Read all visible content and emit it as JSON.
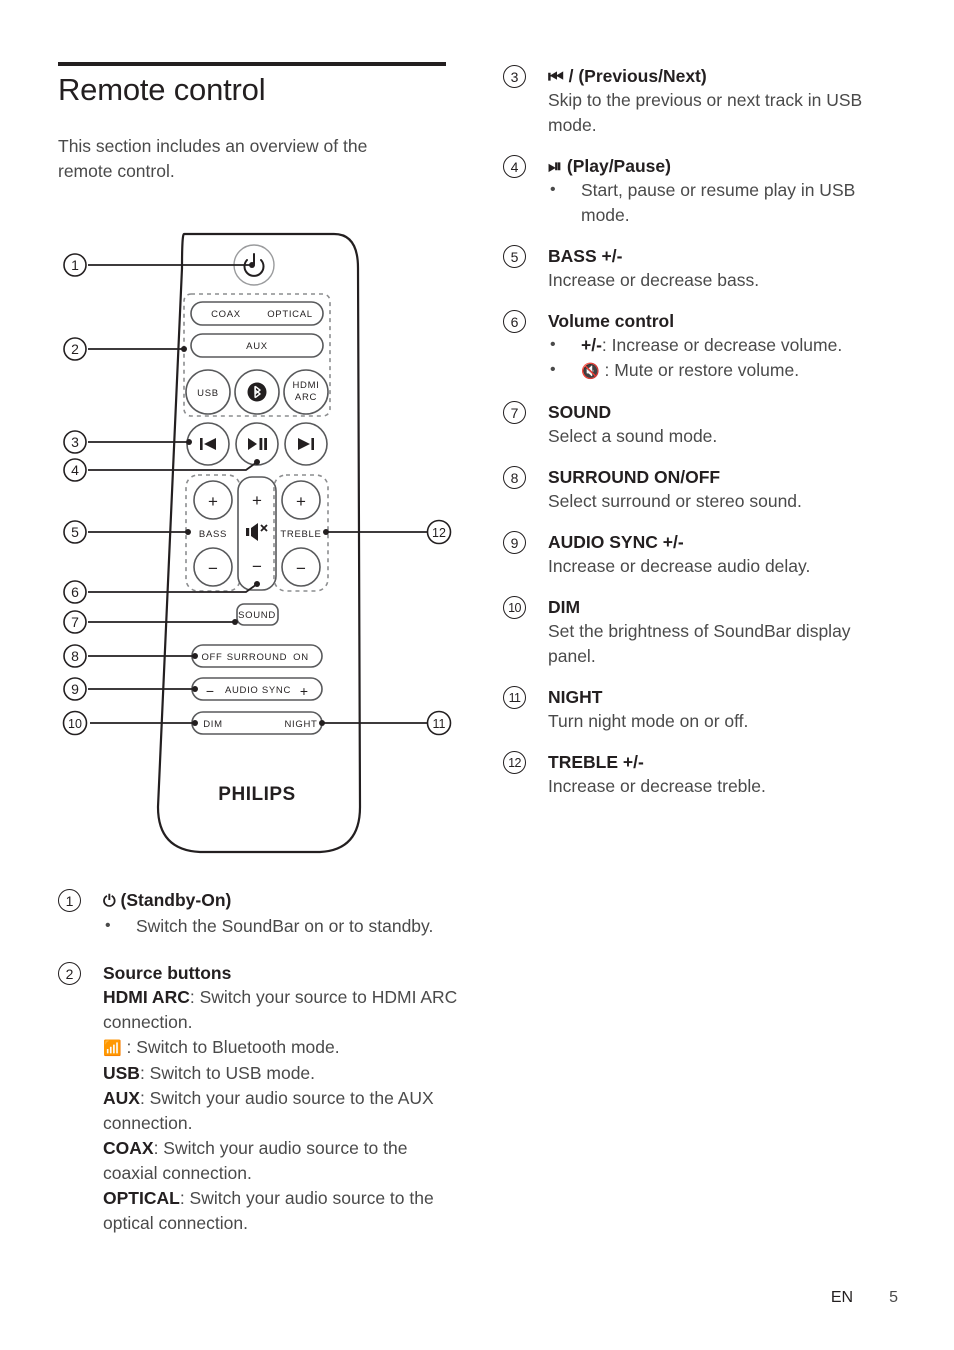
{
  "heading": {
    "title": "Remote control",
    "intro": "This section includes an overview of the remote control."
  },
  "remote": {
    "brand": "PHILIPS",
    "power_icon": "power-standby-icon",
    "buttons": {
      "coax": "COAX",
      "optical": "OPTICAL",
      "aux": "AUX",
      "usb": "USB",
      "bluetooth": "bluetooth-icon",
      "hdmi_arc_line1": "HDMI",
      "hdmi_arc_line2": "ARC",
      "previous": "previous-track-icon",
      "play_pause": "play-pause-icon",
      "next": "next-track-icon",
      "bass_plus": "+",
      "bass_label": "BASS",
      "bass_minus": "−",
      "volume_plus": "+",
      "volume_mute": "mute-icon",
      "volume_minus": "−",
      "treble_plus": "+",
      "treble_label": "TREBLE",
      "treble_minus": "−",
      "sound": "SOUND",
      "surround_off": "OFF",
      "surround_label": "SURROUND",
      "surround_on": "ON",
      "audio_sync_minus": "−",
      "audio_sync_label": "AUDIO SYNC",
      "audio_sync_plus": "+",
      "dim": "DIM",
      "night": "NIGHT"
    },
    "callouts": [
      "1",
      "2",
      "3",
      "4",
      "5",
      "6",
      "7",
      "8",
      "9",
      "10",
      "11",
      "12"
    ]
  },
  "legend_left": [
    {
      "num": "1",
      "title_glyph": "⏻",
      "title": " (Standby-On)",
      "bullets": [
        "Switch the SoundBar on or to standby."
      ]
    },
    {
      "num": "2",
      "title": "Source buttons",
      "lines": [
        {
          "term": "HDMI ARC",
          "rest": ": Switch your source to HDMI ARC connection."
        },
        {
          "term": "ᛗ",
          "rest": " : Switch to Bluetooth mode."
        },
        {
          "term": "USB",
          "rest": ": Switch to USB mode."
        },
        {
          "term": "AUX",
          "rest": ": Switch your audio source to the AUX connection."
        },
        {
          "term": "COAX",
          "rest": ": Switch your audio source to the coaxial connection."
        },
        {
          "term": "OPTICAL",
          "rest": ": Switch your audio source to the optical connection."
        }
      ]
    }
  ],
  "legend_right": [
    {
      "num": "3",
      "title": " / (Previous/Next)",
      "desc": "Skip to the previous or next track in USB mode."
    },
    {
      "num": "4",
      "title": " (Play/Pause)",
      "bullets": [
        "Start, pause or resume play in USB mode."
      ]
    },
    {
      "num": "5",
      "title": "BASS +/-",
      "desc": "Increase or decrease bass."
    },
    {
      "num": "6",
      "title": "Volume control",
      "bullets_rich": [
        {
          "term": "+/-",
          "rest": ": Increase or decrease volume."
        },
        {
          "term": "",
          "rest": " : Mute or restore volume."
        }
      ]
    },
    {
      "num": "7",
      "title": "SOUND",
      "desc": "Select a sound mode."
    },
    {
      "num": "8",
      "title": "SURROUND ON/OFF",
      "desc": "Select surround or stereo sound."
    },
    {
      "num": "9",
      "title": "AUDIO SYNC +/-",
      "desc": "Increase or decrease audio delay."
    },
    {
      "num": "10",
      "title": "DIM",
      "desc": "Set the brightness of SoundBar display panel."
    },
    {
      "num": "11",
      "title": "NIGHT",
      "desc": "Turn night mode on or off."
    },
    {
      "num": "12",
      "title": "TREBLE +/-",
      "desc": "Increase or decrease treble."
    }
  ],
  "footer": {
    "language": "EN",
    "page": "5"
  },
  "colors": {
    "ink": "#231f20",
    "body_text": "#4a4a4a",
    "rule": "#231f20"
  }
}
